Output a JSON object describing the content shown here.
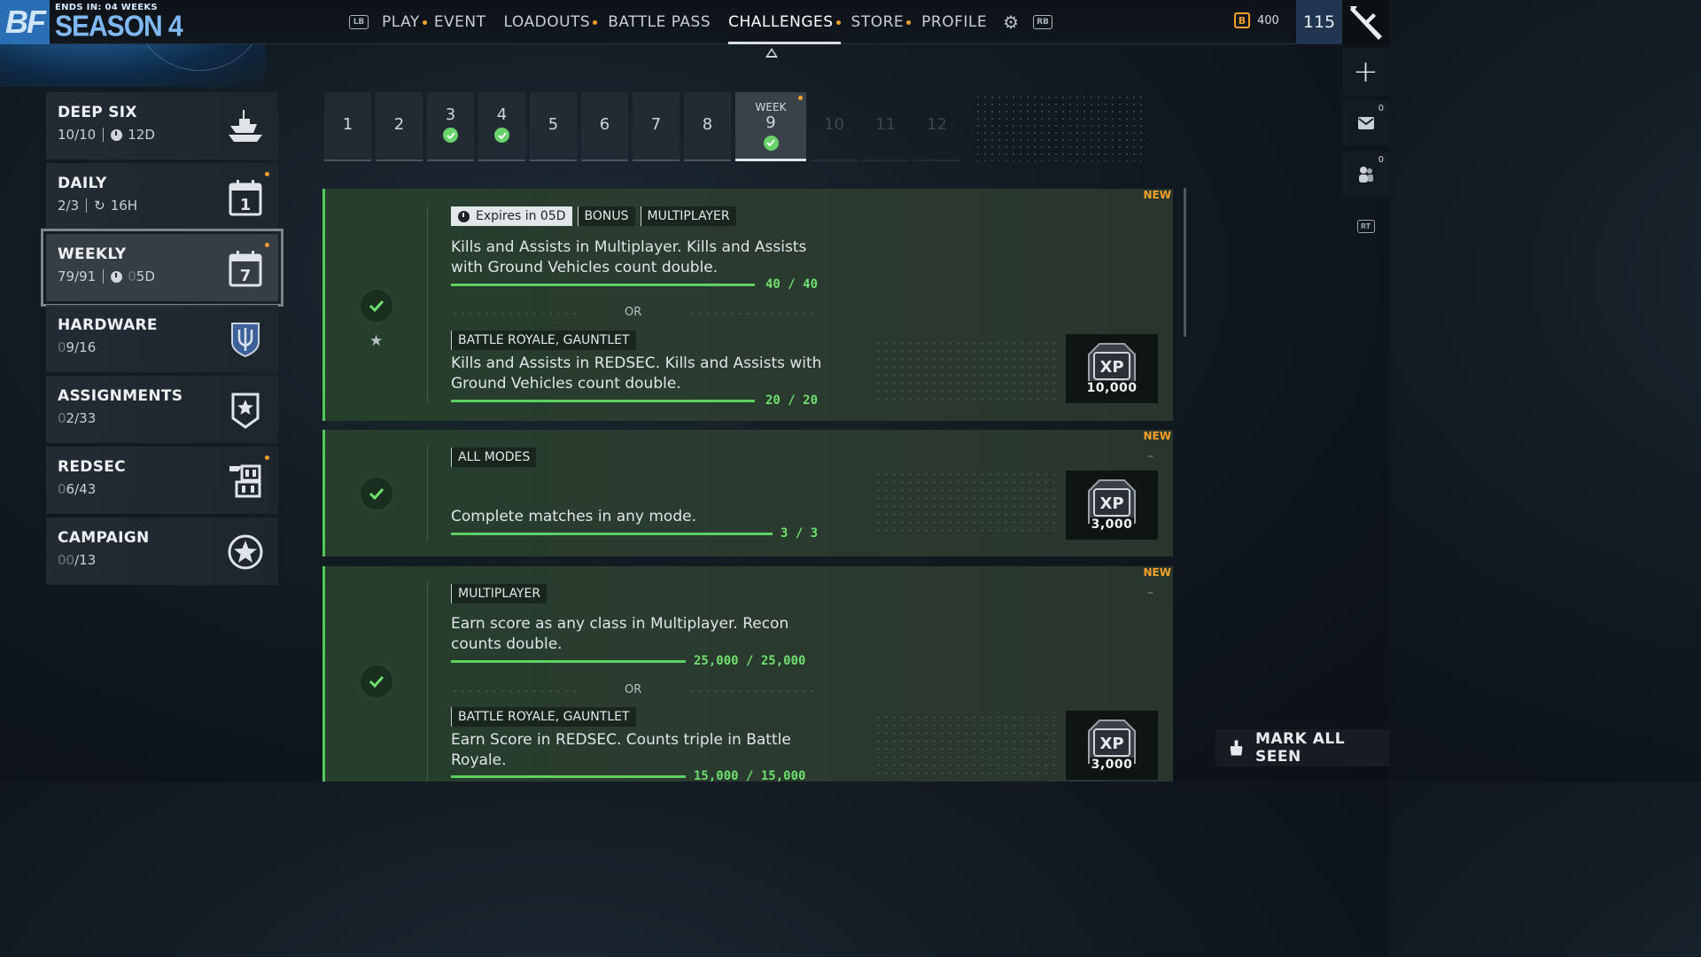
{
  "season": {
    "logo": "BF",
    "ends": "ENDS IN: 04 WEEKS",
    "title": "SEASON 4"
  },
  "nav": {
    "left_bumper": "LB",
    "right_bumper": "RB",
    "items": [
      {
        "label": "PLAY",
        "dot": true
      },
      {
        "label": "EVENT",
        "dot": false
      },
      {
        "label": "LOADOUTS",
        "dot": true
      },
      {
        "label": "BATTLE PASS",
        "dot": false
      },
      {
        "label": "CHALLENGES",
        "dot": true,
        "active": true
      },
      {
        "label": "STORE",
        "dot": true
      },
      {
        "label": "PROFILE",
        "dot": false
      }
    ]
  },
  "currency": {
    "amount": "400",
    "icon": "battlefield-coin-icon"
  },
  "player_level": "115",
  "rail": {
    "mail_count": "0",
    "squad_count": "0",
    "trigger": "RT"
  },
  "sidebar": {
    "items": [
      {
        "title": "DEEP SIX",
        "progress": "10/10",
        "timer": "12D",
        "icon": "warship-icon"
      },
      {
        "title": "DAILY",
        "progress": "2/3",
        "timer": "16H",
        "icon": "calendar-day-icon",
        "calendar": "1",
        "dot": true
      },
      {
        "title": "WEEKLY",
        "progress": "79/91",
        "timer_dim": "0",
        "timer": "5D",
        "icon": "calendar-week-icon",
        "calendar": "7",
        "dot": true,
        "active": true
      },
      {
        "title": "HARDWARE",
        "progress_dim": "0",
        "progress": "9/16",
        "icon": "shield-emblem-icon"
      },
      {
        "title": "ASSIGNMENTS",
        "progress_dim": "0",
        "progress": "2/33",
        "icon": "badge-star-icon"
      },
      {
        "title": "REDSEC",
        "progress_dim": "0",
        "progress": "6/43",
        "icon": "redsec-logo-icon",
        "dot": true
      },
      {
        "title": "CAMPAIGN",
        "progress_dim": "00",
        "progress": "/13",
        "icon": "circle-star-icon"
      }
    ]
  },
  "weeks": {
    "current_label": "WEEK",
    "items": [
      {
        "num": "1",
        "done": false
      },
      {
        "num": "2",
        "done": false
      },
      {
        "num": "3",
        "done": true
      },
      {
        "num": "4",
        "done": true
      },
      {
        "num": "5",
        "done": false
      },
      {
        "num": "6",
        "done": false
      },
      {
        "num": "7",
        "done": false
      },
      {
        "num": "8",
        "done": false
      },
      {
        "num": "9",
        "done": true,
        "current": true
      },
      {
        "num": "10",
        "future": true
      },
      {
        "num": "11",
        "future": true
      },
      {
        "num": "12",
        "future": true
      }
    ]
  },
  "challenges": [
    {
      "new": "NEW",
      "expires": "Expires in 05D",
      "tags": [
        "BONUS",
        "MULTIPLAYER"
      ],
      "desc": "Kills and Assists in Multiplayer. Kills and Assists with Ground Vehicles count double.",
      "progress": "40 / 40",
      "progress_fraction": 1.0,
      "or": "OR",
      "alt_tags": [
        "BATTLE ROYALE, GAUNTLET"
      ],
      "alt_desc": "Kills and Assists in REDSEC. Kills and Assists with Ground Vehicles count double.",
      "alt_progress": "20 / 20",
      "alt_progress_fraction": 1.0,
      "reward": "10,000"
    },
    {
      "new": "NEW",
      "dash": "–",
      "tags": [
        "ALL MODES"
      ],
      "desc": "Complete matches in any mode.",
      "progress": "3 / 3",
      "progress_fraction": 1.0,
      "reward": "3,000"
    },
    {
      "new": "NEW",
      "dash": "–",
      "tags": [
        "MULTIPLAYER"
      ],
      "desc": "Earn score as any class in Multiplayer. Recon counts double.",
      "progress": "25,000 / 25,000",
      "progress_fraction": 1.0,
      "or": "OR",
      "alt_tags": [
        "BATTLE ROYALE, GAUNTLET"
      ],
      "alt_desc": "Earn Score in REDSEC. Counts triple in Battle Royale.",
      "alt_progress": "15,000 / 15,000",
      "reward": "3,000"
    }
  ],
  "mark_all_seen": "MARK ALL SEEN",
  "colors": {
    "accent_green": "#5fd062",
    "notify_orange": "#f3a12a",
    "season_blue": "#2a6fb5"
  }
}
